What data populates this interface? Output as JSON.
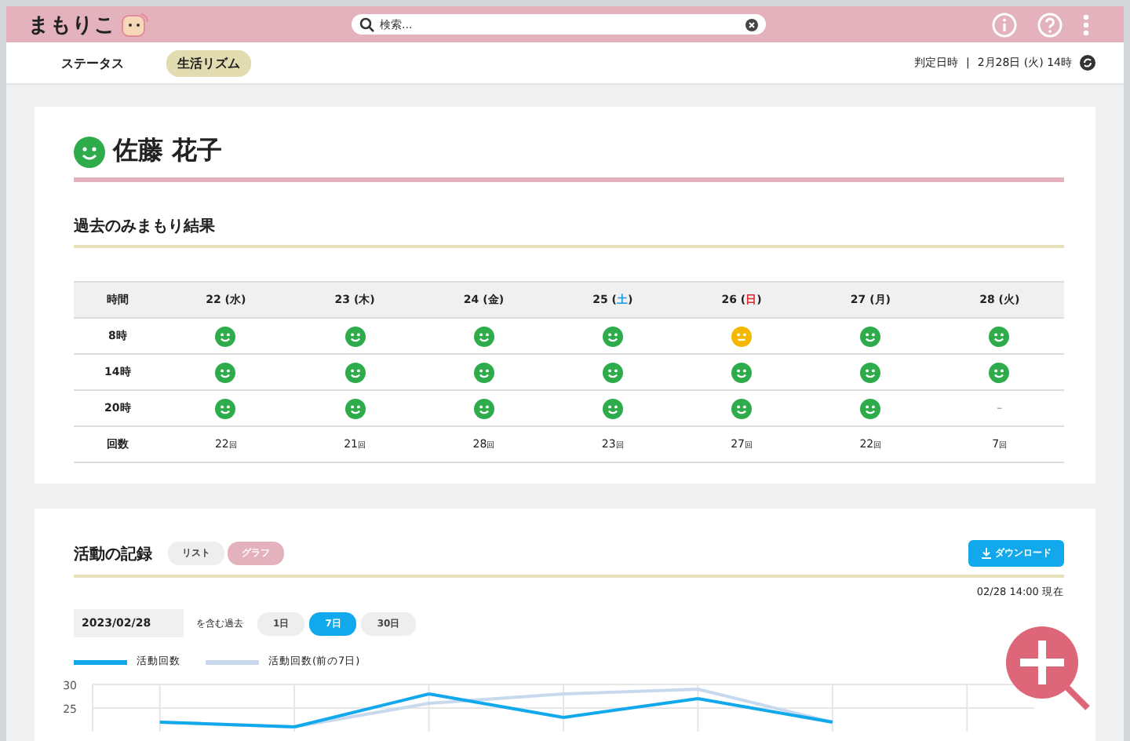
{
  "header": {
    "logo": "まもりこ",
    "search": {
      "placeholder": "検索..."
    }
  },
  "nav": {
    "tabs": [
      {
        "label": "ステータス",
        "selected": false
      },
      {
        "label": "生活リズム",
        "selected": true
      }
    ],
    "judged_label": "判定日時",
    "separator": "|",
    "judged_value": "2月28日 (火) 14時"
  },
  "person": {
    "name": "佐藤 花子",
    "good": true
  },
  "results": {
    "title": "過去のみまもり結果",
    "columns": [
      {
        "label": "時間"
      },
      {
        "prefix": "22 (",
        "weekday": "水",
        "suffix": ")",
        "color": "#222222"
      },
      {
        "prefix": "23 (",
        "weekday": "木",
        "suffix": ")",
        "color": "#222222"
      },
      {
        "prefix": "24 (",
        "weekday": "金",
        "suffix": ")",
        "color": "#222222"
      },
      {
        "prefix": "25 (",
        "weekday": "土",
        "suffix": ")",
        "color": "#1a9be0"
      },
      {
        "prefix": "26 (",
        "weekday": "日",
        "suffix": ")",
        "color": "#e0282c"
      },
      {
        "prefix": "27 (",
        "weekday": "月",
        "suffix": ")",
        "color": "#222222"
      },
      {
        "prefix": "28 (",
        "weekday": "火",
        "suffix": ")",
        "color": "#222222"
      }
    ],
    "rows": [
      {
        "cells": [
          {
            "kind": "label",
            "text": "8時"
          },
          {
            "kind": "good"
          },
          {
            "kind": "good"
          },
          {
            "kind": "good"
          },
          {
            "kind": "good"
          },
          {
            "kind": "neutral"
          },
          {
            "kind": "good"
          },
          {
            "kind": "good"
          }
        ]
      },
      {
        "cells": [
          {
            "kind": "label",
            "text": "14時"
          },
          {
            "kind": "good"
          },
          {
            "kind": "good"
          },
          {
            "kind": "good"
          },
          {
            "kind": "good"
          },
          {
            "kind": "good"
          },
          {
            "kind": "good"
          },
          {
            "kind": "good"
          }
        ]
      },
      {
        "cells": [
          {
            "kind": "label",
            "text": "20時"
          },
          {
            "kind": "good"
          },
          {
            "kind": "good"
          },
          {
            "kind": "good"
          },
          {
            "kind": "good"
          },
          {
            "kind": "good"
          },
          {
            "kind": "good"
          },
          {
            "kind": "text",
            "text": "–"
          }
        ]
      },
      {
        "cells": [
          {
            "kind": "label",
            "text": "回数"
          },
          {
            "kind": "count",
            "text": "22",
            "unit": "回"
          },
          {
            "kind": "count",
            "text": "21",
            "unit": "回"
          },
          {
            "kind": "count",
            "text": "28",
            "unit": "回"
          },
          {
            "kind": "count",
            "text": "23",
            "unit": "回"
          },
          {
            "kind": "count",
            "text": "27",
            "unit": "回"
          },
          {
            "kind": "count",
            "text": "22",
            "unit": "回"
          },
          {
            "kind": "count",
            "text": "7",
            "unit": "回"
          }
        ]
      }
    ]
  },
  "activity": {
    "title": "活動の記録",
    "views": [
      {
        "label": "リスト",
        "selected": false
      },
      {
        "label": "グラフ",
        "selected": true
      }
    ],
    "download": "ダウンロード",
    "as_of": "02/28 14:00 現在",
    "date": "2023/02/28",
    "range_label": "を含む過去",
    "ranges": [
      {
        "label": "1日",
        "selected": false
      },
      {
        "label": "7日",
        "selected": true
      },
      {
        "label": "30日",
        "selected": false
      }
    ],
    "chart_data": {
      "type": "line",
      "categories": [
        null,
        null,
        null,
        null,
        null,
        null,
        null
      ],
      "ylim": [
        20,
        30
      ],
      "grid": true,
      "yticks": [
        25,
        30
      ],
      "series": [
        {
          "name": "活動回数",
          "color": "#12a8ec",
          "values": [
            22,
            21,
            28,
            23,
            27,
            22,
            null
          ]
        },
        {
          "name": "活動回数(前の7日)",
          "color": "#c8d9ee",
          "values": [
            22,
            21,
            26,
            28,
            29,
            22,
            null
          ]
        }
      ]
    }
  }
}
